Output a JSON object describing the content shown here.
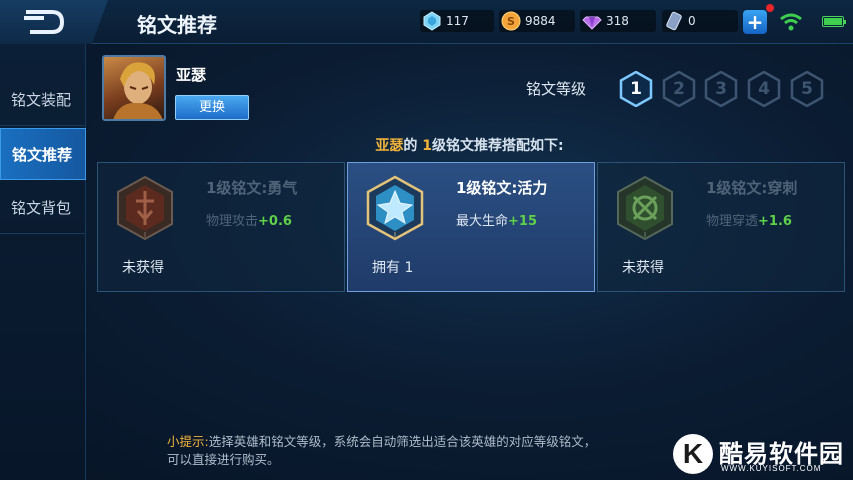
{
  "header": {
    "title": "铭文推荐",
    "resources": [
      {
        "icon": "diamond-icon",
        "value": "117"
      },
      {
        "icon": "gold-coin-icon",
        "value": "9884"
      },
      {
        "icon": "purple-crystal-icon",
        "value": "318"
      },
      {
        "icon": "voucher-icon",
        "value": "0"
      }
    ],
    "add_label": "+"
  },
  "sidebar": {
    "items": [
      {
        "label": "铭文装配",
        "active": false
      },
      {
        "label": "铭文推荐",
        "active": true
      },
      {
        "label": "铭文背包",
        "active": false
      }
    ]
  },
  "hero": {
    "name": "亚瑟",
    "change_label": "更换"
  },
  "level_selector": {
    "label": "铭文等级",
    "levels": [
      "1",
      "2",
      "3",
      "4",
      "5"
    ],
    "selected": "1"
  },
  "recommend": {
    "hero": "亚瑟",
    "suffix": "的",
    "level": "1",
    "text": "级铭文推荐搭配如下:"
  },
  "cards": [
    {
      "title": "1级铭文:勇气",
      "attr": "物理攻击",
      "value": "+0.6",
      "status": "未获得",
      "color": "#b1432a",
      "state": "locked"
    },
    {
      "title": "1级铭文:活力",
      "attr": "最大生命",
      "value": "+15",
      "status": "拥有 1",
      "color": "#2d8fc4",
      "state": "owned"
    },
    {
      "title": "1级铭文:穿刺",
      "attr": "物理穿透",
      "value": "+1.6",
      "status": "未获得",
      "color": "#3f8a3a",
      "state": "locked"
    }
  ],
  "tip": {
    "lead": "小提示:",
    "text": "选择英雄和铭文等级，系统会自动筛选出适合该英雄的对应等级铭文，",
    "text2": "可以直接进行购买。"
  },
  "watermark": {
    "letter": "K",
    "name": "酷易软件园",
    "url": "WWW.KUYISOFT.COM"
  },
  "colors": {
    "accent_blue": "#1a6fc0",
    "gold": "#f2b33a",
    "green_value": "#5fd14a"
  }
}
